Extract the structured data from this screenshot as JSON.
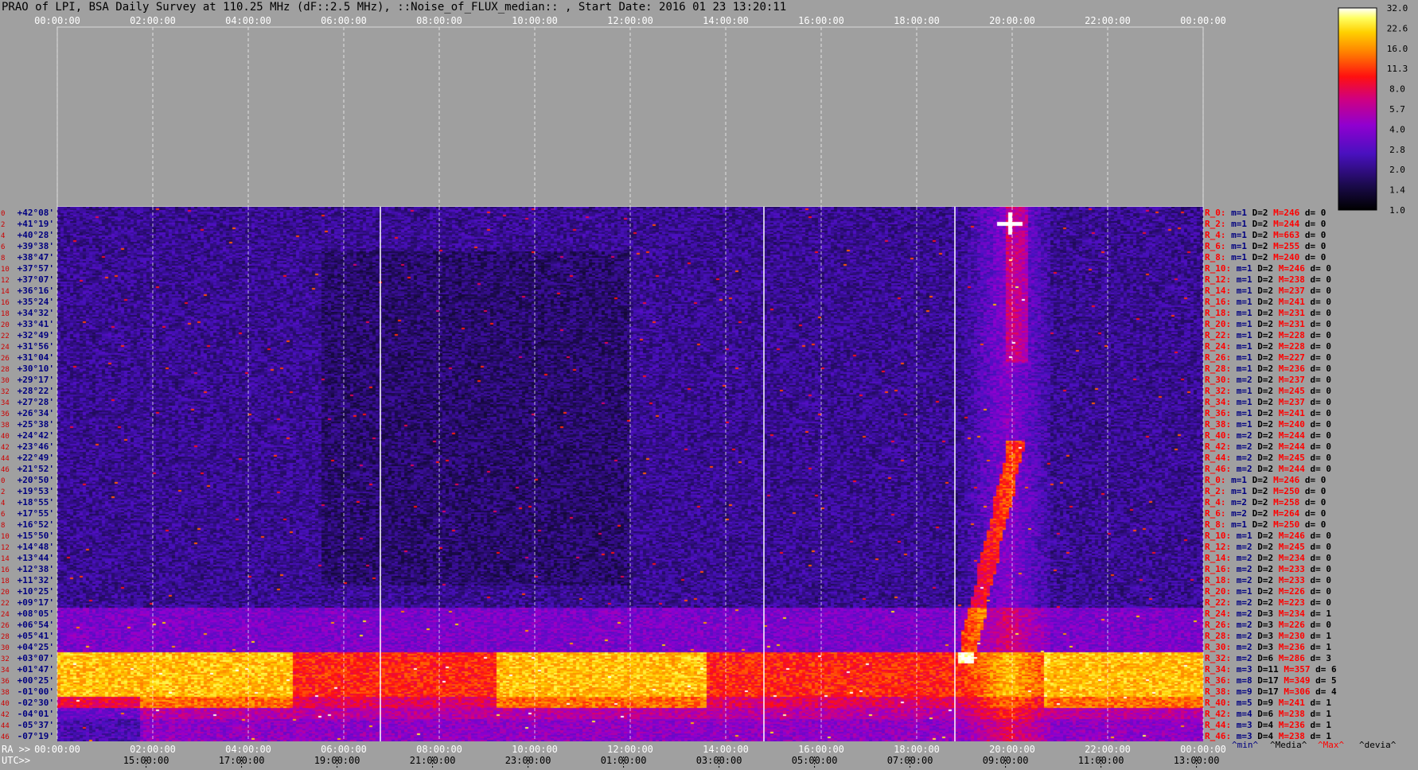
{
  "title": "PRAO of LPI, BSA Daily Survey at 110.25 MHz (dF::2.5 MHz), ::Noise_of_FLUX_median:: , Start Date: 2016 01 23 13:20:11",
  "chart_data": {
    "type": "heatmap",
    "top_ticks": [
      "00:00:00",
      "02:00:00",
      "04:00:00",
      "06:00:00",
      "08:00:00",
      "10:00:00",
      "12:00:00",
      "14:00:00",
      "16:00:00",
      "18:00:00",
      "20:00:00",
      "22:00:00",
      "00:00:00"
    ],
    "ra_prefix": "RA >>",
    "ra_ticks": [
      "00:00:00",
      "02:00:00",
      "04:00:00",
      "06:00:00",
      "08:00:00",
      "10:00:00",
      "12:00:00",
      "14:00:00",
      "16:00:00",
      "18:00:00",
      "20:00:00",
      "22:00:00",
      "00:00:00"
    ],
    "utc_prefix": "UTC>>",
    "utc_ticks": [
      "15:00:00",
      "17:00:00",
      "19:00:00",
      "21:00:00",
      "23:00:00",
      "01:00:00",
      "03:00:00",
      "05:00:00",
      "07:00:00",
      "09:00:00",
      "11:00:00",
      "13:00:00"
    ],
    "declinations": [
      "+42°08'",
      "+41°19'",
      "+40°28'",
      "+39°38'",
      "+38°47'",
      "+37°57'",
      "+37°07'",
      "+36°16'",
      "+35°24'",
      "+34°32'",
      "+33°41'",
      "+32°49'",
      "+31°56'",
      "+31°04'",
      "+30°10'",
      "+29°17'",
      "+28°22'",
      "+27°28'",
      "+26°34'",
      "+25°38'",
      "+24°42'",
      "+23°46'",
      "+22°49'",
      "+21°52'",
      "+20°50'",
      "+19°53'",
      "+18°55'",
      "+17°55'",
      "+16°52'",
      "+15°50'",
      "+14°48'",
      "+13°44'",
      "+12°38'",
      "+11°32'",
      "+10°25'",
      "+09°17'",
      "+08°05'",
      "+06°54'",
      "+05°41'",
      "+04°25'",
      "+03°07'",
      "+01°47'",
      "+00°25'",
      "-01°00'",
      "-02°30'",
      "-04°01'",
      "-05°37'",
      "-07°19'"
    ],
    "row_numbers": [
      "0",
      "2",
      "4",
      "6",
      "8",
      "10",
      "12",
      "14",
      "16",
      "18",
      "20",
      "22",
      "24",
      "26",
      "28",
      "30",
      "32",
      "34",
      "36",
      "38",
      "40",
      "42",
      "44",
      "46",
      "0",
      "2",
      "4",
      "6",
      "8",
      "10",
      "12",
      "14",
      "16",
      "18",
      "20",
      "22",
      "24",
      "26",
      "28",
      "30",
      "32",
      "34",
      "36",
      "38",
      "40",
      "42",
      "44",
      "46"
    ],
    "stats": [
      {
        "r": "R_0:",
        "m": "1",
        "D": "2",
        "M": "246",
        "d": "0"
      },
      {
        "r": "R_2:",
        "m": "1",
        "D": "2",
        "M": "244",
        "d": "0"
      },
      {
        "r": "R_4:",
        "m": "1",
        "D": "2",
        "M": "663",
        "d": "0"
      },
      {
        "r": "R_6:",
        "m": "1",
        "D": "2",
        "M": "255",
        "d": "0"
      },
      {
        "r": "R_8:",
        "m": "1",
        "D": "2",
        "M": "240",
        "d": "0"
      },
      {
        "r": "R_10:",
        "m": "1",
        "D": "2",
        "M": "246",
        "d": "0"
      },
      {
        "r": "R_12:",
        "m": "1",
        "D": "2",
        "M": "238",
        "d": "0"
      },
      {
        "r": "R_14:",
        "m": "1",
        "D": "2",
        "M": "237",
        "d": "0"
      },
      {
        "r": "R_16:",
        "m": "1",
        "D": "2",
        "M": "241",
        "d": "0"
      },
      {
        "r": "R_18:",
        "m": "1",
        "D": "2",
        "M": "231",
        "d": "0"
      },
      {
        "r": "R_20:",
        "m": "1",
        "D": "2",
        "M": "231",
        "d": "0"
      },
      {
        "r": "R_22:",
        "m": "1",
        "D": "2",
        "M": "228",
        "d": "0"
      },
      {
        "r": "R_24:",
        "m": "1",
        "D": "2",
        "M": "228",
        "d": "0"
      },
      {
        "r": "R_26:",
        "m": "1",
        "D": "2",
        "M": "227",
        "d": "0"
      },
      {
        "r": "R_28:",
        "m": "1",
        "D": "2",
        "M": "236",
        "d": "0"
      },
      {
        "r": "R_30:",
        "m": "2",
        "D": "2",
        "M": "237",
        "d": "0"
      },
      {
        "r": "R_32:",
        "m": "1",
        "D": "2",
        "M": "245",
        "d": "0"
      },
      {
        "r": "R_34:",
        "m": "1",
        "D": "2",
        "M": "237",
        "d": "0"
      },
      {
        "r": "R_36:",
        "m": "1",
        "D": "2",
        "M": "241",
        "d": "0"
      },
      {
        "r": "R_38:",
        "m": "1",
        "D": "2",
        "M": "240",
        "d": "0"
      },
      {
        "r": "R_40:",
        "m": "2",
        "D": "2",
        "M": "244",
        "d": "0"
      },
      {
        "r": "R_42:",
        "m": "2",
        "D": "2",
        "M": "244",
        "d": "0"
      },
      {
        "r": "R_44:",
        "m": "2",
        "D": "2",
        "M": "245",
        "d": "0"
      },
      {
        "r": "R_46:",
        "m": "2",
        "D": "2",
        "M": "244",
        "d": "0"
      },
      {
        "r": "R_0:",
        "m": "1",
        "D": "2",
        "M": "246",
        "d": "0"
      },
      {
        "r": "R_2:",
        "m": "1",
        "D": "2",
        "M": "250",
        "d": "0"
      },
      {
        "r": "R_4:",
        "m": "2",
        "D": "2",
        "M": "258",
        "d": "0"
      },
      {
        "r": "R_6:",
        "m": "2",
        "D": "2",
        "M": "264",
        "d": "0"
      },
      {
        "r": "R_8:",
        "m": "1",
        "D": "2",
        "M": "250",
        "d": "0"
      },
      {
        "r": "R_10:",
        "m": "1",
        "D": "2",
        "M": "246",
        "d": "0"
      },
      {
        "r": "R_12:",
        "m": "2",
        "D": "2",
        "M": "245",
        "d": "0"
      },
      {
        "r": "R_14:",
        "m": "2",
        "D": "2",
        "M": "234",
        "d": "0"
      },
      {
        "r": "R_16:",
        "m": "2",
        "D": "2",
        "M": "233",
        "d": "0"
      },
      {
        "r": "R_18:",
        "m": "2",
        "D": "2",
        "M": "233",
        "d": "0"
      },
      {
        "r": "R_20:",
        "m": "1",
        "D": "2",
        "M": "226",
        "d": "0"
      },
      {
        "r": "R_22:",
        "m": "2",
        "D": "2",
        "M": "223",
        "d": "0"
      },
      {
        "r": "R_24:",
        "m": "2",
        "D": "3",
        "M": "234",
        "d": "1"
      },
      {
        "r": "R_26:",
        "m": "2",
        "D": "3",
        "M": "226",
        "d": "0"
      },
      {
        "r": "R_28:",
        "m": "2",
        "D": "3",
        "M": "230",
        "d": "1"
      },
      {
        "r": "R_30:",
        "m": "2",
        "D": "3",
        "M": "236",
        "d": "1"
      },
      {
        "r": "R_32:",
        "m": "2",
        "D": "6",
        "M": "286",
        "d": "3"
      },
      {
        "r": "R_34:",
        "m": "3",
        "D": "11",
        "M": "357",
        "d": "6"
      },
      {
        "r": "R_36:",
        "m": "8",
        "D": "17",
        "M": "349",
        "d": "5"
      },
      {
        "r": "R_38:",
        "m": "9",
        "D": "17",
        "M": "306",
        "d": "4"
      },
      {
        "r": "R_40:",
        "m": "5",
        "D": "9",
        "M": "241",
        "d": "1"
      },
      {
        "r": "R_42:",
        "m": "4",
        "D": "6",
        "M": "238",
        "d": "1"
      },
      {
        "r": "R_44:",
        "m": "3",
        "D": "4",
        "M": "236",
        "d": "1"
      },
      {
        "r": "R_46:",
        "m": "3",
        "D": "4",
        "M": "238",
        "d": "1"
      }
    ],
    "legend_keys": [
      {
        "label": "^min^",
        "color": "#000080"
      },
      {
        "label": "^Media^",
        "color": "#000000"
      },
      {
        "label": "^Max^",
        "color": "#ff0000"
      },
      {
        "label": "^devia^",
        "color": "#000000"
      }
    ],
    "colorbar_ticks": [
      "32.0",
      "22.6",
      "16.0",
      "11.3",
      "8.0",
      "5.7",
      "4.0",
      "2.8",
      "2.0",
      "1.4",
      "1.0"
    ],
    "colorbar_scale": "log",
    "colors": {
      "background": "#a0a0a0",
      "row_label": "#000080",
      "row_number": "#cc0000",
      "stat_label": "#ff0000"
    }
  }
}
